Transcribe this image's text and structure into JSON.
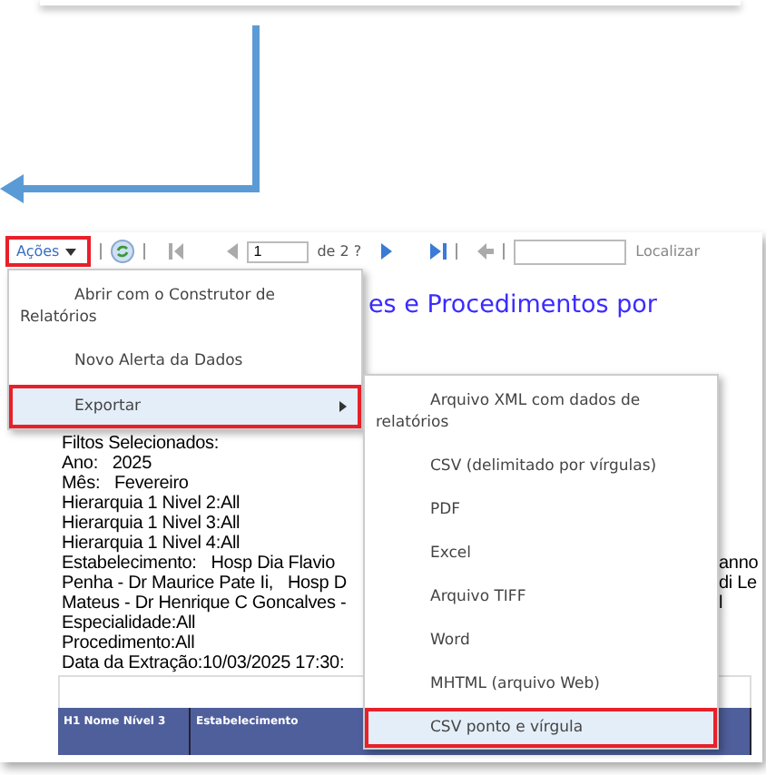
{
  "toolbar": {
    "actions": {
      "label": "Ações",
      "marked": true
    },
    "page": {
      "value": "1",
      "of": "de 2 ?"
    },
    "find": {
      "label": "Localizar"
    }
  },
  "report": {
    "title": "es e Procedimentos por",
    "lines": [
      {
        "text": "Filtos Selecionados:"
      },
      {
        "text": "Ano:   2025"
      },
      {
        "text": "Mês:   Fevereiro"
      },
      {
        "text": "Hierarquia 1 Nivel 2:All"
      },
      {
        "text": "Hierarquia 1 Nivel 3:All"
      },
      {
        "text": "Hierarquia 1 Nivel 4:All"
      },
      {
        "text": "Estabelecimento:   Hosp Dia Flavio",
        "tail": "anno"
      },
      {
        "text": "Penha - Dr Maurice Pate Ii,   Hosp D",
        "tail": "di Le"
      },
      {
        "text": "Mateus - Dr Henrique C Goncalves -",
        "tail": "l"
      },
      {
        "text": "Especialidade:All"
      },
      {
        "text": "Procedimento:All"
      },
      {
        "text": "Data da Extração:10/03/2025 17:30:"
      }
    ],
    "table": {
      "columns": [
        "H1 Nome Nível 3",
        "Estabelecimento"
      ]
    }
  },
  "menu": {
    "items": [
      {
        "label": "Abrir com o Construtor de Relatórios",
        "selected": false,
        "submenu": false
      },
      {
        "label": "Novo Alerta da Dados",
        "selected": false,
        "submenu": false
      },
      {
        "label": "Exportar",
        "selected": true,
        "submenu": true
      }
    ]
  },
  "submenu": {
    "items": [
      {
        "label": "Arquivo XML com dados de relatórios",
        "selected": false
      },
      {
        "label": "CSV (delimitado por vírgulas)",
        "selected": false
      },
      {
        "label": "PDF",
        "selected": false
      },
      {
        "label": "Excel",
        "selected": false
      },
      {
        "label": "Arquivo TIFF",
        "selected": false
      },
      {
        "label": "Word",
        "selected": false
      },
      {
        "label": "MHTML (arquivo Web)",
        "selected": false
      },
      {
        "label": "CSV ponto e vírgula",
        "selected": true
      }
    ]
  }
}
